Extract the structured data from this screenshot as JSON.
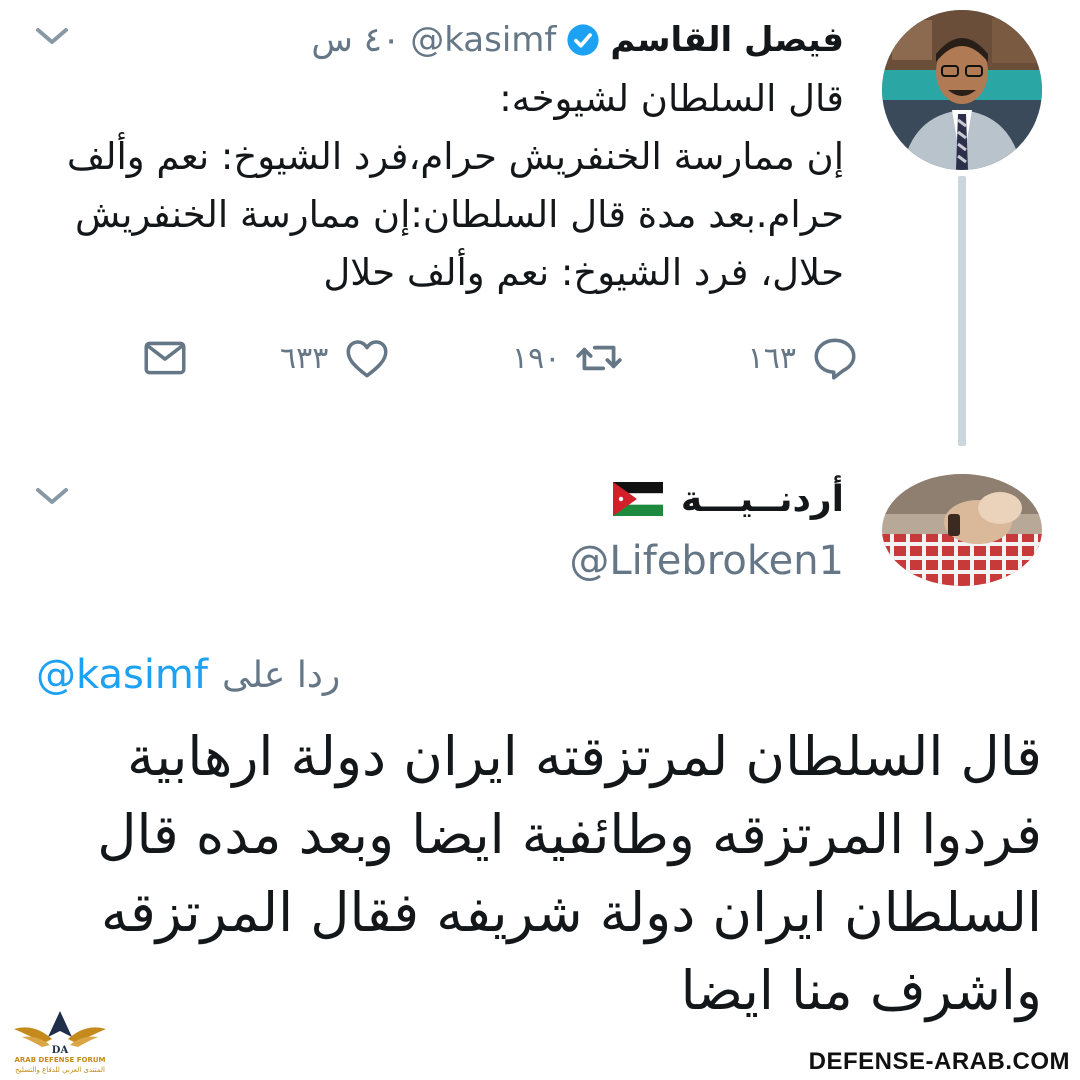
{
  "tweet1": {
    "name": "فيصل القاسم",
    "handle": "@kasimf",
    "time": "٤٠ س",
    "body_lines": [
      "قال السلطان لشيوخه:",
      "إن ممارسة الخنفريش حرام،فرد الشيوخ: نعم وألف",
      "حرام.بعد مدة قال السلطان:إن ممارسة الخنفريش",
      "حلال، فرد الشيوخ: نعم وألف حلال"
    ],
    "replies": "١٦٣",
    "retweets": "١٩٠",
    "likes": "٦٣٣",
    "icons": [
      "verified-badge-icon",
      "chevron-down-icon",
      "reply-icon",
      "retweet-icon",
      "like-icon",
      "message-icon"
    ]
  },
  "tweet2": {
    "name": "أردنــيـــة",
    "handle": "@Lifebroken1",
    "reply_to_label": "ردا على",
    "reply_to_handle": "@kasimf",
    "body_lines": [
      "قال السلطان لمرتزقته ايران دولة ارهابية",
      "فردوا المرتزقه وطائفية ايضا وبعد مده قال",
      "السلطان ايران دولة شريفه فقال المرتزقه",
      "واشرف منا ايضا"
    ],
    "icons": [
      "jordan-flag-icon",
      "chevron-down-icon"
    ]
  },
  "watermark": {
    "site": "DEFENSE-ARAB.COM",
    "logo_line1": "ARAB DEFENSE FORUM",
    "logo_line2": "المنتدى العربي للدفاع والتسليح"
  },
  "colors": {
    "accent": "#1da1f2",
    "muted": "#657786",
    "text": "#14171a",
    "thread_line": "#ccd6dd"
  }
}
